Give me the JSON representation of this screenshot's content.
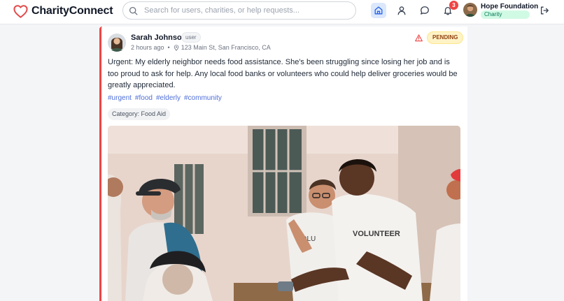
{
  "app": {
    "name": "CharityConnect"
  },
  "search": {
    "placeholder": "Search for users, charities, or help requests..."
  },
  "notifications": {
    "count": "3"
  },
  "current_user": {
    "name": "Hope Foundation",
    "role": "Charity"
  },
  "post": {
    "author": "Sarah Johnson",
    "author_role": "user",
    "time": "2 hours ago",
    "separator": "•",
    "location": "123 Main St, San Francisco, CA",
    "status": "PENDING",
    "text": "Urgent: My elderly neighbor needs food assistance. She's been struggling since losing her job and is too proud to ask for help. Any local food banks or volunteers who could help deliver groceries would be greatly appreciated.",
    "tags": [
      "#urgent",
      "#food",
      "#elderly",
      "#community"
    ],
    "category": "Category: Food Aid",
    "photo_volunteer_shirt": "VOLUNTEER"
  },
  "icons": {
    "logo": "heart-icon",
    "search": "search-icon",
    "home": "home-icon",
    "profile": "user-icon",
    "chat": "chat-icon",
    "notifications": "bell-icon",
    "logout": "logout-icon",
    "location": "map-pin-icon",
    "flag": "warning-icon"
  },
  "colors": {
    "brand_heart": "#e24b4b",
    "card_accent": "#ef4444",
    "active_nav": "#dbe7fb",
    "pending_bg": "#fef3c7",
    "charity_badge_bg": "#d1fae5",
    "tag_link": "#4f6fd8"
  }
}
